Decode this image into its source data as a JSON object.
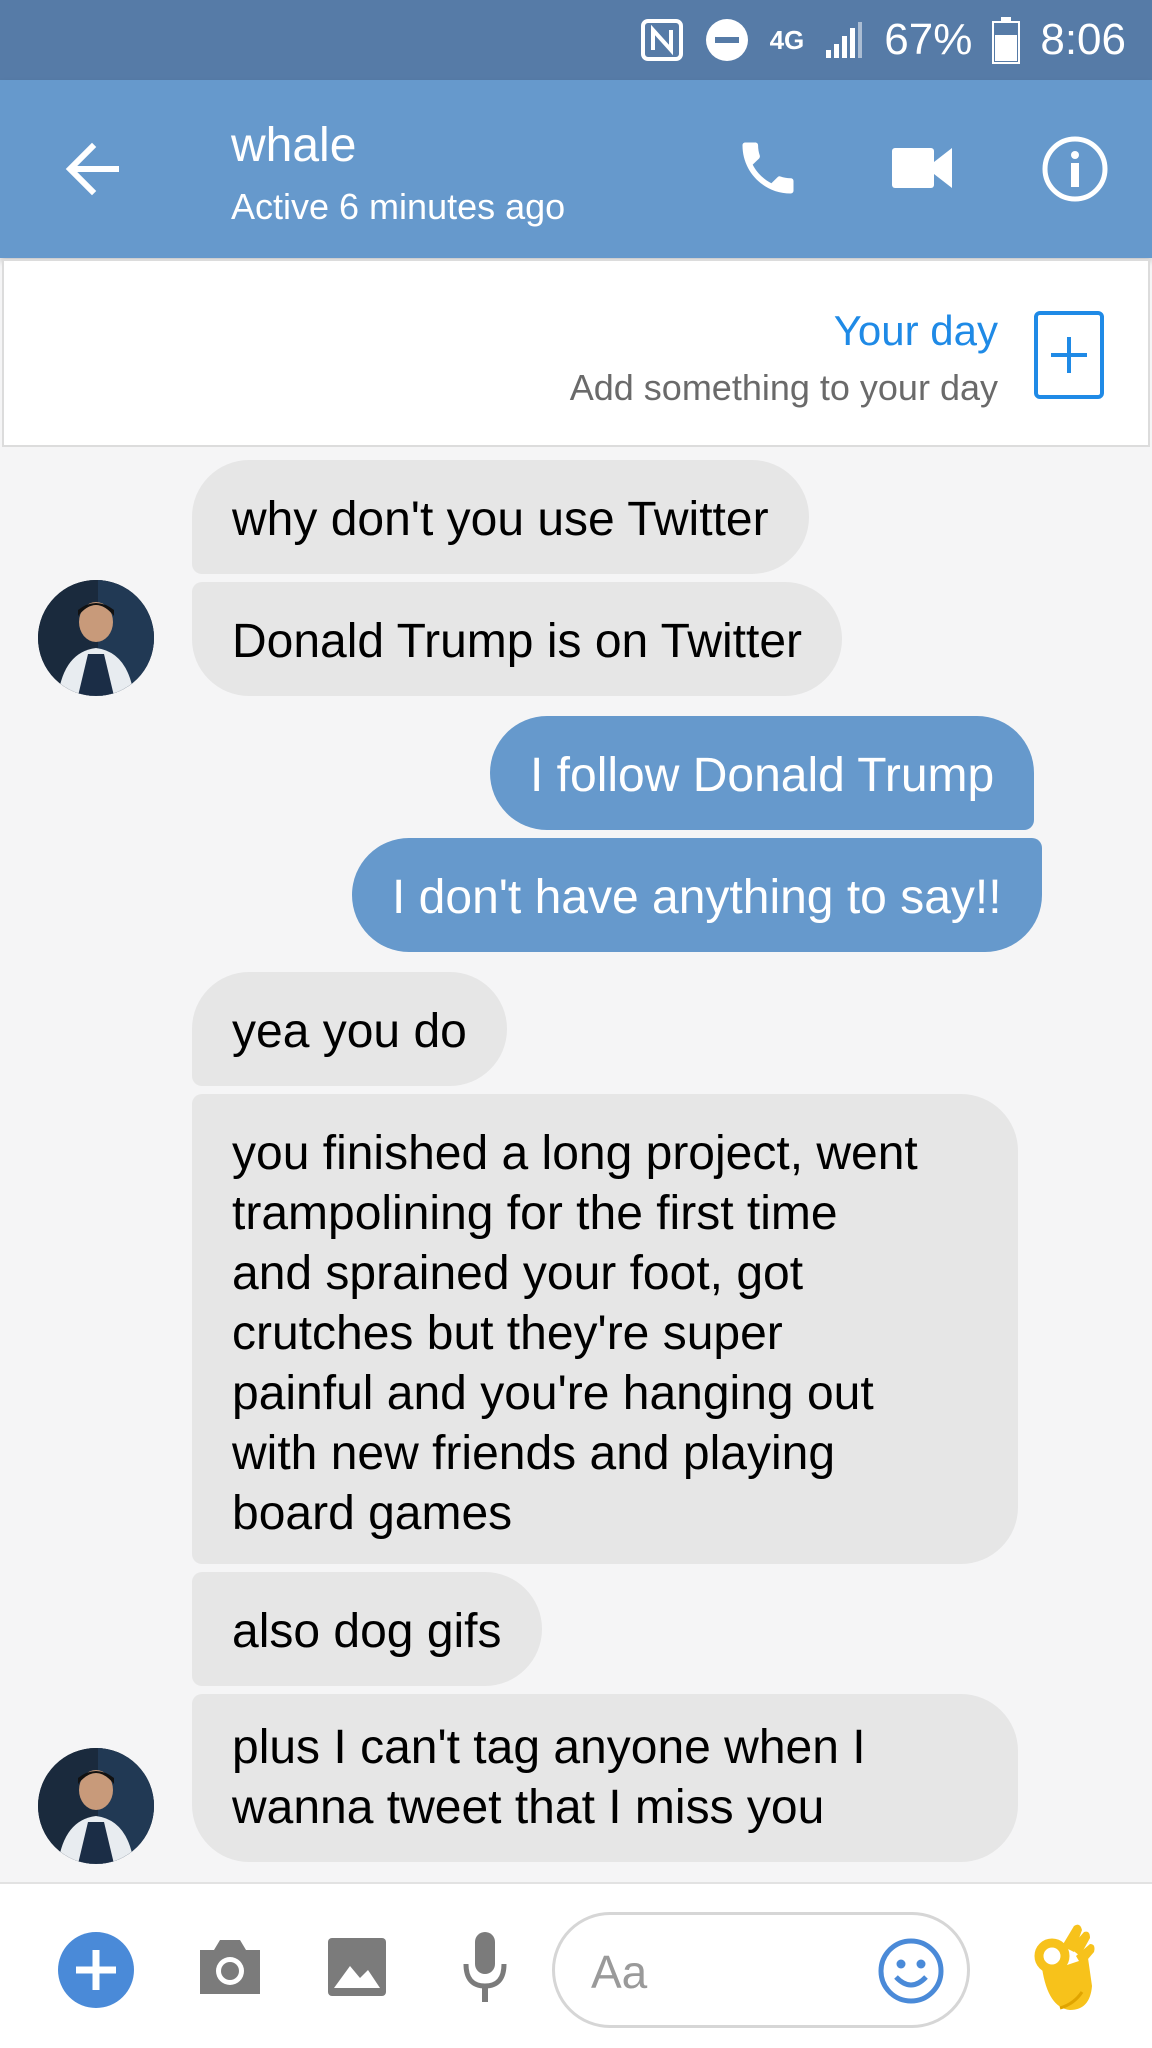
{
  "status_bar": {
    "network": "4G",
    "battery": "67%",
    "time": "8:06"
  },
  "header": {
    "contact_name": "whale",
    "contact_status": "Active 6 minutes ago",
    "icons": [
      "back-arrow-icon",
      "phone-icon",
      "video-camera-icon",
      "info-icon"
    ]
  },
  "your_day": {
    "title": "Your day",
    "subtitle": "Add something to your day"
  },
  "messages": [
    {
      "from": "them",
      "text": "why don't you use Twitter"
    },
    {
      "from": "them",
      "text": "Donald Trump is on Twitter"
    },
    {
      "from": "me",
      "text": "I follow Donald Trump"
    },
    {
      "from": "me",
      "text": "I don't have anything to say!!"
    },
    {
      "from": "them",
      "text": "yea you do"
    },
    {
      "from": "them",
      "lines": [
        "you finished a long project, went",
        "trampolining for the first time",
        "and sprained your foot, got",
        "crutches but they're super",
        "painful and you're hanging out",
        "with new friends and playing",
        "board games"
      ]
    },
    {
      "from": "them",
      "text": "also dog gifs"
    },
    {
      "from": "them",
      "lines": [
        "plus I can't tag anyone when I",
        "wanna tweet that I miss you"
      ]
    }
  ],
  "composer": {
    "placeholder": "Aa",
    "icons": [
      "plus-icon",
      "camera-icon",
      "image-icon",
      "microphone-icon",
      "emoji-icon",
      "ok-hand-emoji-icon"
    ]
  },
  "colors": {
    "status_bar": "#567ba7",
    "header": "#6699cc",
    "outgoing_bubble": "#6699cc",
    "incoming_bubble": "#e6e6e6",
    "accent": "#1f8ae6"
  }
}
